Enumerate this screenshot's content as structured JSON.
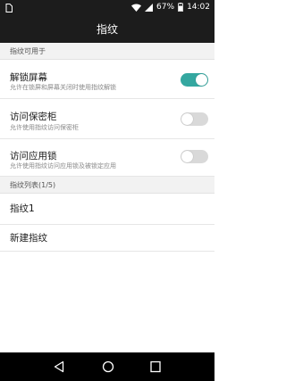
{
  "status_bar": {
    "battery_percent": "67%",
    "time": "14:02"
  },
  "app_bar": {
    "title": "指纹"
  },
  "sections": {
    "usage_header": "指纹可用于",
    "list_header": "指纹列表(1/5)"
  },
  "settings": [
    {
      "title": "解锁屏幕",
      "subtitle": "允许在锁屏和屏幕关闭时使用指纹解锁",
      "enabled": true
    },
    {
      "title": "访问保密柜",
      "subtitle": "允许使用指纹访问保密柜",
      "enabled": false
    },
    {
      "title": "访问应用锁",
      "subtitle": "允许使用指纹访问应用锁及被锁定应用",
      "enabled": false
    }
  ],
  "fingerprints": {
    "item1": "指纹1",
    "add_new": "新建指纹"
  },
  "colors": {
    "toggle_on": "#34a7a0",
    "toggle_off": "#d9d9d9",
    "bar_bg": "#1c1c1c",
    "header_bg": "#f2f2f2"
  },
  "icons": [
    "sim-icon",
    "wifi-icon",
    "signal-icon",
    "battery-icon",
    "back-icon",
    "home-icon",
    "recents-icon"
  ]
}
